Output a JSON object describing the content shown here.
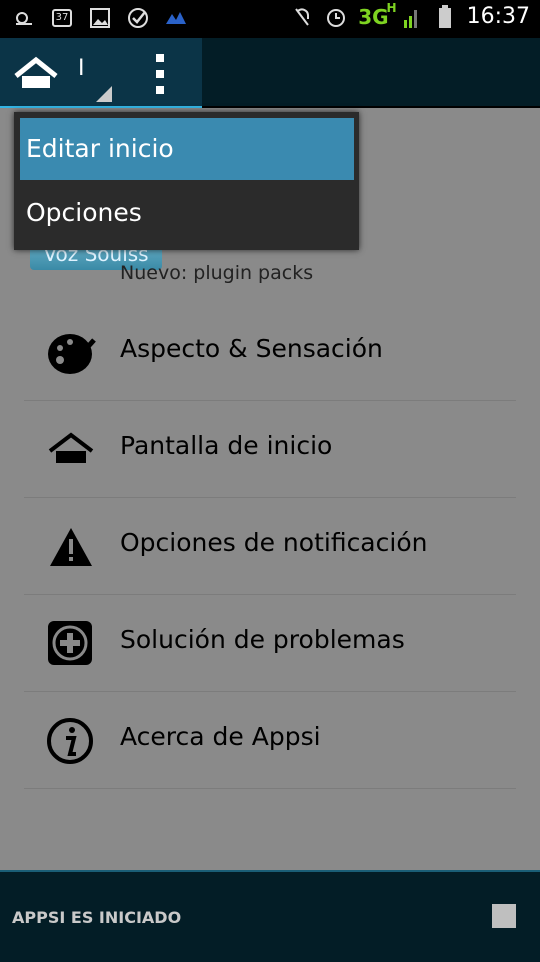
{
  "status_bar": {
    "time": "16:37",
    "network": "3G",
    "network_sub": "H",
    "battery_badge": "37",
    "icons": [
      "weather-icon",
      "battery-37-icon",
      "image-icon",
      "check-circle-icon",
      "app-icon",
      "mute-icon",
      "alarm-icon",
      "signal-icon",
      "battery-icon"
    ]
  },
  "action_bar": {
    "title_fragment": "I",
    "home_icon": "home-icon",
    "overflow_icon": "overflow-menu-icon"
  },
  "dropdown": {
    "items": [
      {
        "label": "Editar inicio",
        "active": true
      },
      {
        "label": "Opciones",
        "active": false
      }
    ]
  },
  "plugin": {
    "badge": "Voz Soulss",
    "subtitle": "Nuevo: plugin packs"
  },
  "menu_list": [
    {
      "label": "Aspecto & Sensación",
      "icon": "palette-icon"
    },
    {
      "label": "Pantalla de inicio",
      "icon": "home-icon"
    },
    {
      "label": "Opciones de notificación",
      "icon": "warning-icon"
    },
    {
      "label": "Solución de problemas",
      "icon": "plus-box-icon"
    },
    {
      "label": "Acerca de Appsi",
      "icon": "info-icon"
    }
  ],
  "notification": {
    "text": "APPSI ES INICIADO",
    "stop_icon": "stop-icon"
  }
}
